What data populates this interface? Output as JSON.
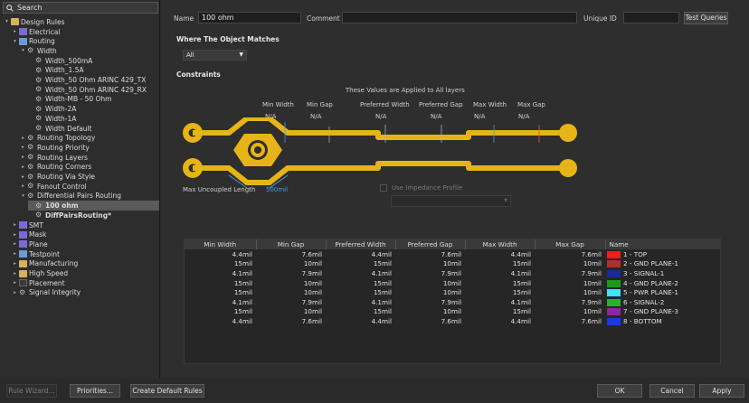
{
  "search": {
    "label": "Search"
  },
  "tree": [
    {
      "label": "Design Rules",
      "level": 0,
      "arrow": "▾",
      "icon": "folder",
      "bold": false
    },
    {
      "label": "Electrical",
      "level": 1,
      "arrow": "▸",
      "icon": "el",
      "bold": false
    },
    {
      "label": "Routing",
      "level": 1,
      "arrow": "▾",
      "icon": "rt",
      "bold": false
    },
    {
      "label": "Width",
      "level": 2,
      "arrow": "▾",
      "icon": "rule",
      "bold": false
    },
    {
      "label": "Width_500mA",
      "level": 3,
      "arrow": "",
      "icon": "rule",
      "bold": false
    },
    {
      "label": "Width_1.5A",
      "level": 3,
      "arrow": "",
      "icon": "rule",
      "bold": false
    },
    {
      "label": "Width_50 Ohm ARINC 429_TX",
      "level": 3,
      "arrow": "",
      "icon": "rule",
      "bold": false
    },
    {
      "label": "Width_50 Ohm ARINC 429_RX",
      "level": 3,
      "arrow": "",
      "icon": "rule",
      "bold": false
    },
    {
      "label": "Width-MB - 50 Ohm",
      "level": 3,
      "arrow": "",
      "icon": "rule",
      "bold": false
    },
    {
      "label": "Width-2A",
      "level": 3,
      "arrow": "",
      "icon": "rule",
      "bold": false
    },
    {
      "label": "Width-1A",
      "level": 3,
      "arrow": "",
      "icon": "rule",
      "bold": false
    },
    {
      "label": "Width Default",
      "level": 3,
      "arrow": "",
      "icon": "rule",
      "bold": false
    },
    {
      "label": "Routing Topology",
      "level": 2,
      "arrow": "▸",
      "icon": "rule",
      "bold": false
    },
    {
      "label": "Routing Priority",
      "level": 2,
      "arrow": "▸",
      "icon": "rule",
      "bold": false
    },
    {
      "label": "Routing Layers",
      "level": 2,
      "arrow": "▸",
      "icon": "rule",
      "bold": false
    },
    {
      "label": "Routing Corners",
      "level": 2,
      "arrow": "▸",
      "icon": "rule",
      "bold": false
    },
    {
      "label": "Routing Via Style",
      "level": 2,
      "arrow": "▸",
      "icon": "rule",
      "bold": false
    },
    {
      "label": "Fanout Control",
      "level": 2,
      "arrow": "▸",
      "icon": "rule",
      "bold": false
    },
    {
      "label": "Differential Pairs Routing",
      "level": 2,
      "arrow": "▾",
      "icon": "rule",
      "bold": false
    },
    {
      "label": "100 ohm",
      "level": 3,
      "arrow": "",
      "icon": "rule",
      "bold": true,
      "selected": true
    },
    {
      "label": "DiffPairsRouting*",
      "level": 3,
      "arrow": "",
      "icon": "rule",
      "bold": true
    },
    {
      "label": "SMT",
      "level": 1,
      "arrow": "▸",
      "icon": "el",
      "bold": false
    },
    {
      "label": "Mask",
      "level": 1,
      "arrow": "▸",
      "icon": "el",
      "bold": false
    },
    {
      "label": "Plane",
      "level": 1,
      "arrow": "▸",
      "icon": "el",
      "bold": false
    },
    {
      "label": "Testpoint",
      "level": 1,
      "arrow": "▸",
      "icon": "rt",
      "bold": false
    },
    {
      "label": "Manufacturing",
      "level": 1,
      "arrow": "▸",
      "icon": "folder",
      "bold": false
    },
    {
      "label": "High Speed",
      "level": 1,
      "arrow": "▸",
      "icon": "folder",
      "bold": false
    },
    {
      "label": "Placement",
      "level": 1,
      "arrow": "▸",
      "icon": "sel",
      "bold": false
    },
    {
      "label": "Signal Integrity",
      "level": 1,
      "arrow": "▸",
      "icon": "rule",
      "bold": false
    }
  ],
  "form": {
    "name_label": "Name",
    "name_value": "100 ohm",
    "comment_label": "Comment",
    "comment_value": "",
    "uid_label": "Unique ID",
    "uid_value": "",
    "test_queries": "Test Queries",
    "where_header": "Where The Object Matches",
    "where_value": "All",
    "constraints_header": "Constraints",
    "applied_note": "These Values are Applied to All layers",
    "diagram_labels": [
      "Min Width",
      "Min Gap",
      "Preferred Width",
      "Preferred Gap",
      "Max Width",
      "Max Gap"
    ],
    "diagram_values": [
      "N/A",
      "N/A",
      "N/A",
      "N/A",
      "N/A",
      "N/A"
    ],
    "uncoupled_label": "Max Uncoupled Length",
    "uncoupled_value": "500mil",
    "impedance_label": "Use Impedance Profile"
  },
  "table": {
    "columns": [
      "Min Width",
      "Min Gap",
      "Preferred Width",
      "Preferred Gap",
      "Max Width",
      "Max Gap",
      "Name"
    ],
    "rows": [
      {
        "cells": [
          "4.4mil",
          "7.6mil",
          "4.4mil",
          "7.6mil",
          "4.4mil",
          "7.6mil"
        ],
        "name": "1 - TOP",
        "color": "#ff1a1a"
      },
      {
        "cells": [
          "15mil",
          "10mil",
          "15mil",
          "10mil",
          "15mil",
          "10mil"
        ],
        "name": "2 - GND PLANE-1",
        "color": "#b03030"
      },
      {
        "cells": [
          "4.1mil",
          "7.9mil",
          "4.1mil",
          "7.9mil",
          "4.1mil",
          "7.9mil"
        ],
        "name": "3 - SIGNAL-1",
        "color": "#1a2a9a"
      },
      {
        "cells": [
          "15mil",
          "10mil",
          "15mil",
          "10mil",
          "15mil",
          "10mil"
        ],
        "name": "4 - GND PLANE-2",
        "color": "#1a9a1a"
      },
      {
        "cells": [
          "15mil",
          "10mil",
          "15mil",
          "10mil",
          "15mil",
          "10mil"
        ],
        "name": "5 - PWR PLANE-1",
        "color": "#40e0ff"
      },
      {
        "cells": [
          "4.1mil",
          "7.9mil",
          "4.1mil",
          "7.9mil",
          "4.1mil",
          "7.9mil"
        ],
        "name": "6 - SIGNAL-2",
        "color": "#2ab02a"
      },
      {
        "cells": [
          "15mil",
          "10mil",
          "15mil",
          "10mil",
          "15mil",
          "10mil"
        ],
        "name": "7 - GND PLANE-3",
        "color": "#8a2a9a"
      },
      {
        "cells": [
          "4.4mil",
          "7.6mil",
          "4.4mil",
          "7.6mil",
          "4.4mil",
          "7.6mil"
        ],
        "name": "8 - BOTTOM",
        "color": "#1a3ae0"
      }
    ]
  },
  "footer": {
    "rule_wizard": "Rule Wizard...",
    "priorities": "Priorities...",
    "create_default": "Create Default Rules",
    "ok": "OK",
    "cancel": "Cancel",
    "apply": "Apply"
  },
  "colors": {
    "trace": "#e6b416",
    "accent": "#4a9be8",
    "background": "#2b2b2b"
  }
}
